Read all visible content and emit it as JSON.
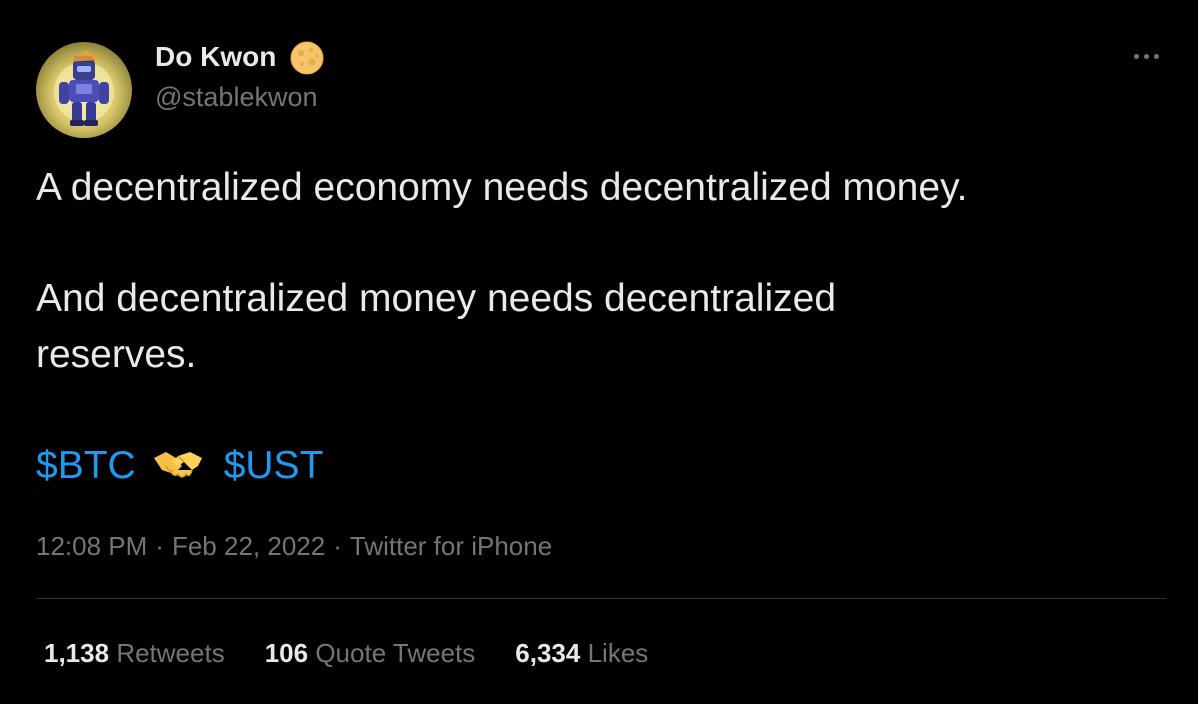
{
  "author": {
    "display_name": "Do Kwon",
    "handle": "@stablekwon",
    "avatar_icon": "robot-avatar",
    "badge_icon": "moon-badge-icon"
  },
  "tweet": {
    "line1": "A decentralized economy needs decentralized money.",
    "line2": "And decentralized money needs decentralized",
    "line3": "reserves.",
    "cashtag1": "$BTC",
    "emoji": "handshake-icon",
    "cashtag2": "$UST"
  },
  "meta": {
    "time": "12:08 PM",
    "separator": "·",
    "date": "Feb 22, 2022",
    "source": "Twitter for iPhone"
  },
  "stats": {
    "retweets_count": "1,138",
    "retweets_label": "Retweets",
    "quotes_count": "106",
    "quotes_label": "Quote Tweets",
    "likes_count": "6,334",
    "likes_label": "Likes"
  },
  "colors": {
    "background": "#000000",
    "primary_text": "#e7e9ea",
    "secondary_text": "#71767b",
    "link": "#1d9bf0",
    "divider": "#2f3336"
  }
}
